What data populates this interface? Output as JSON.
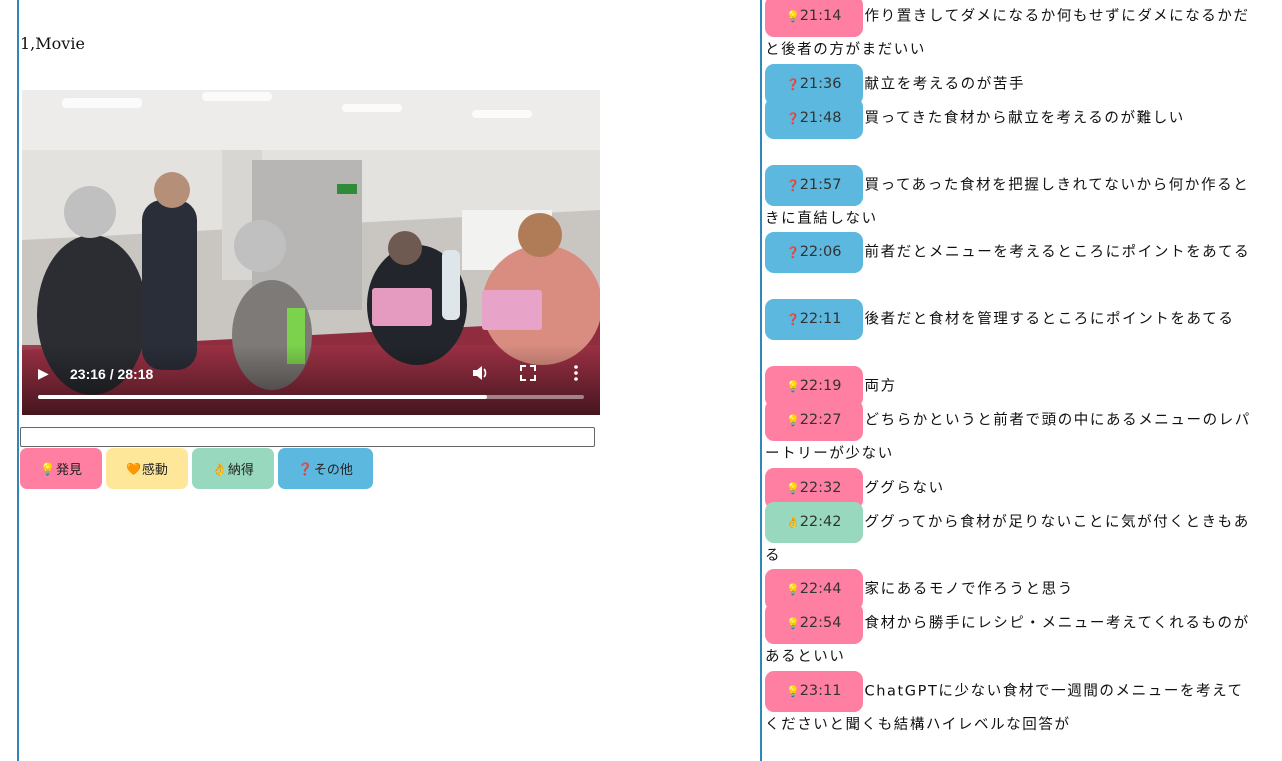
{
  "section": {
    "title": "1,Movie"
  },
  "video": {
    "time_display": "23:16 / 28:18",
    "progress": 0.822
  },
  "note_input": {
    "value": "",
    "placeholder": ""
  },
  "categories": [
    {
      "key": "discovery",
      "icon": "💡",
      "label": "発見",
      "color": "#ff7fa3"
    },
    {
      "key": "moved",
      "icon": "🧡",
      "label": "感動",
      "color": "#ffe79a"
    },
    {
      "key": "convinced",
      "icon": "👌",
      "label": "納得",
      "color": "#97d8be"
    },
    {
      "key": "other",
      "icon": "❓",
      "label": "その他",
      "color": "#5cb8de"
    }
  ],
  "log": [
    {
      "time": "21:14",
      "icon": "💡",
      "color": "#ff7fa3",
      "text": "作り置きしてダメになるか何もせずにダメになるかだと後者の方がまだいい"
    },
    {
      "time": "21:36",
      "icon": "❓",
      "color": "#5cb8de",
      "text": "献立を考えるのが苦手"
    },
    {
      "time": "21:48",
      "icon": "❓",
      "color": "#5cb8de",
      "text": "買ってきた食材から献立を考えるのが難しい",
      "gap_after": true
    },
    {
      "time": "21:57",
      "icon": "❓",
      "color": "#5cb8de",
      "text": "買ってあった食材を把握しきれてないから何か作るときに直結しない"
    },
    {
      "time": "22:06",
      "icon": "❓",
      "color": "#5cb8de",
      "text": "前者だとメニューを考えるところにポイントをあてる",
      "gap_after": true
    },
    {
      "time": "22:11",
      "icon": "❓",
      "color": "#5cb8de",
      "text": "後者だと食材を管理するところにポイントをあてる",
      "gap_after": true
    },
    {
      "time": "22:19",
      "icon": "💡",
      "color": "#ff7fa3",
      "text": "両方"
    },
    {
      "time": "22:27",
      "icon": "💡",
      "color": "#ff7fa3",
      "text": "どちらかというと前者で頭の中にあるメニューのレパートリーが少ない"
    },
    {
      "time": "22:32",
      "icon": "💡",
      "color": "#ff7fa3",
      "text": "ググらない"
    },
    {
      "time": "22:42",
      "icon": "👌",
      "color": "#97d8be",
      "text": "ググってから食材が足りないことに気が付くときもある"
    },
    {
      "time": "22:44",
      "icon": "💡",
      "color": "#ff7fa3",
      "text": "家にあるモノで作ろうと思う"
    },
    {
      "time": "22:54",
      "icon": "💡",
      "color": "#ff7fa3",
      "text": "食材から勝手にレシピ・メニュー考えてくれるものがあるといい"
    },
    {
      "time": "23:11",
      "icon": "💡",
      "color": "#ff7fa3",
      "text": "ChatGPTに少ない食材で一週間のメニューを考えてくださいと聞くも結構ハイレベルな回答が"
    }
  ]
}
